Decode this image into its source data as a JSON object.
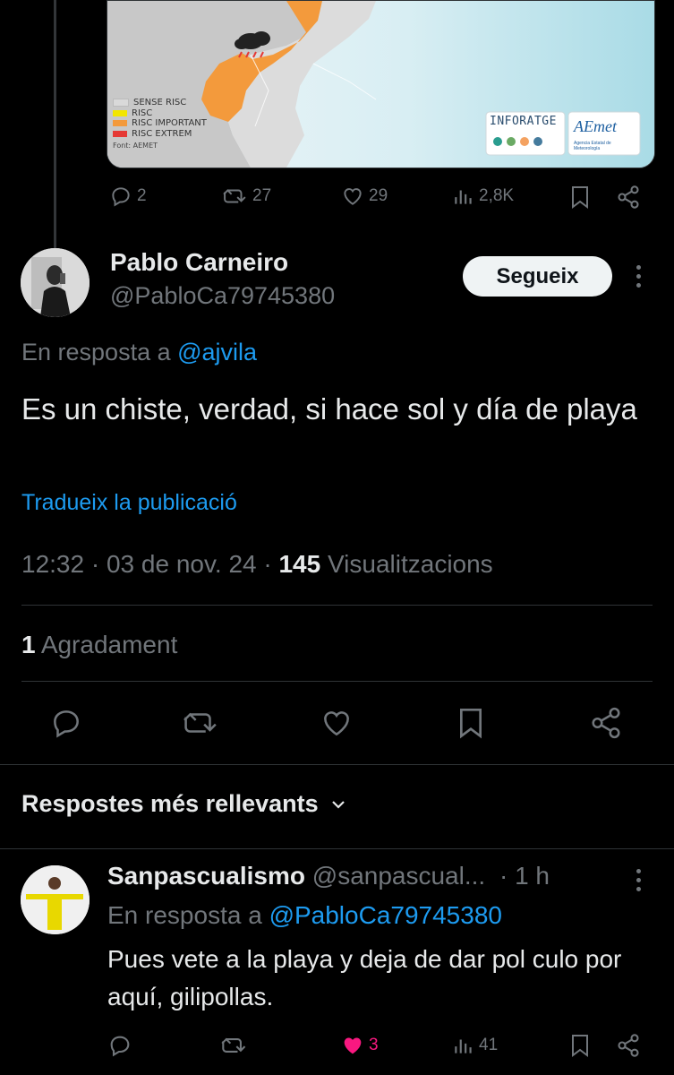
{
  "quoted_tweet": {
    "map": {
      "legend": [
        {
          "label": "SENSE RISC",
          "color": "#d9d9d9"
        },
        {
          "label": "RISC",
          "color": "#f2e600"
        },
        {
          "label": "RISC IMPORTANT",
          "color": "#f39a3c"
        },
        {
          "label": "RISC EXTREM",
          "color": "#e53935"
        }
      ],
      "source": "Font: AEMET",
      "logo_left": "INFORATGE",
      "logo_right": "AEmet",
      "logo_right_sub": "Agencia Estatal de Meteorología"
    },
    "actions": {
      "replies": "2",
      "retweets": "27",
      "likes": "29",
      "views": "2,8K"
    }
  },
  "tweet": {
    "author_name": "Pablo Carneiro",
    "author_handle": "@PabloCa79745380",
    "follow_label": "Segueix",
    "reply_to_prefix": "En resposta a",
    "reply_to_handle": "@ajvila",
    "text": "Es un chiste, verdad, si hace sol y día de playa",
    "translate_label": "Tradueix la publicació",
    "time": "12:32",
    "date": "03 de nov. 24",
    "views_count": "145",
    "views_label": "Visualitzacions",
    "likes_count": "1",
    "likes_label": "Agradament"
  },
  "replies_section": {
    "sort_label": "Respostes més rellevants"
  },
  "reply": {
    "author_name": "Sanpascualismo",
    "author_handle": "@sanpascual...",
    "age": "1 h",
    "reply_to_prefix": "En resposta a",
    "reply_to_handle": "@PabloCa79745380",
    "text": "Pues vete a la playa y deja de dar pol culo por aquí, gilipollas.",
    "likes": "3",
    "views": "41"
  },
  "colors": {
    "background": "#000000",
    "text": "#e7e9ea",
    "muted": "#71767b",
    "link": "#1d9bf0",
    "like_active": "#f91880",
    "risk_orange": "#f39a3c"
  }
}
